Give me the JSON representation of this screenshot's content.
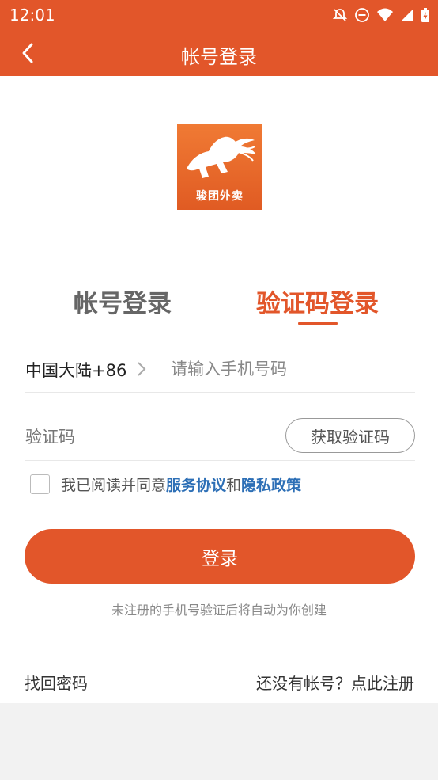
{
  "status_bar": {
    "time": "12:01",
    "icons": [
      "notifications-off-icon",
      "do-not-disturb-icon",
      "wifi-icon",
      "signal-icon",
      "battery-charging-icon"
    ]
  },
  "app_bar": {
    "title": "帐号登录",
    "back_icon": "chevron-left-icon"
  },
  "logo": {
    "text": "骏团外卖"
  },
  "tabs": [
    {
      "label": "帐号登录",
      "active": false
    },
    {
      "label": "验证码登录",
      "active": true
    }
  ],
  "phone": {
    "country_code": "中国大陆+86",
    "placeholder": "请输入手机号码",
    "value": ""
  },
  "code": {
    "placeholder": "验证码",
    "value": "",
    "get_code_label": "获取验证码"
  },
  "agreement": {
    "prefix": "我已阅读并同意",
    "service_link": "服务协议",
    "conjunction": "和",
    "privacy_link": "隐私政策",
    "checked": false
  },
  "login_button": "登录",
  "hint": "未注册的手机号验证后将自动为你创建",
  "footer": {
    "forgot": "找回密码",
    "register": "还没有帐号？点此注册"
  },
  "colors": {
    "accent": "#e2562a",
    "link": "#2d6fb6"
  }
}
